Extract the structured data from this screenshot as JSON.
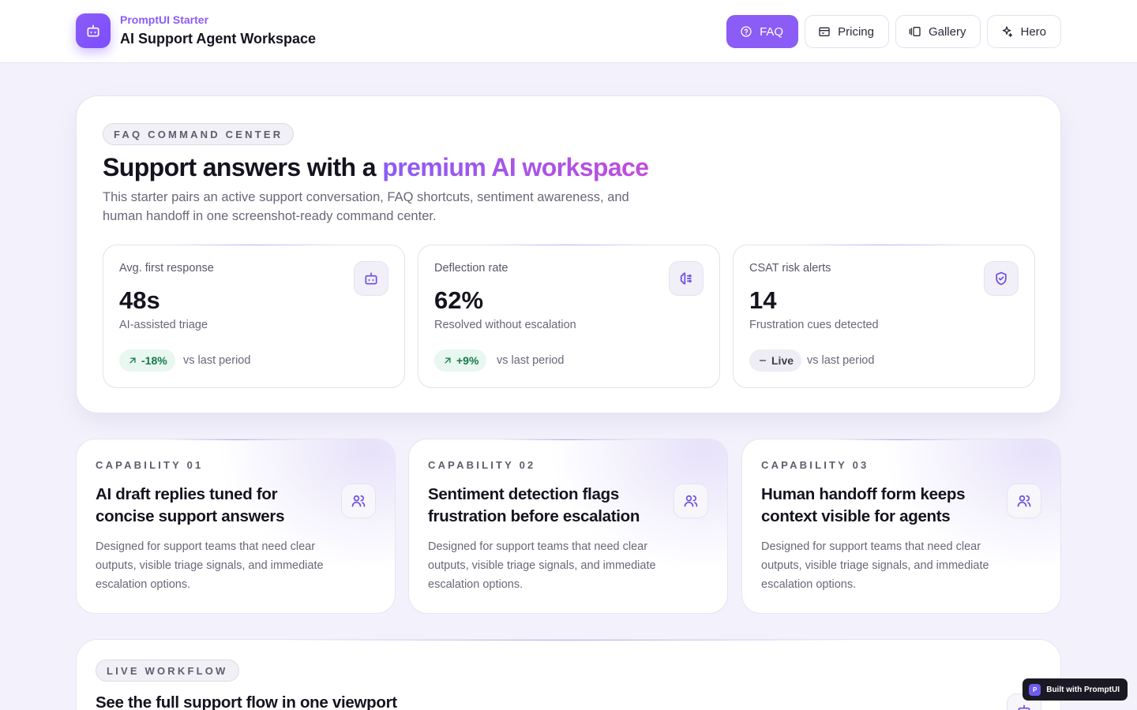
{
  "brand": {
    "eyebrow": "PromptUI Starter",
    "title": "AI Support Agent Workspace",
    "logo_icon": "bot-icon"
  },
  "nav": [
    {
      "label": "FAQ",
      "icon": "help-circle-icon",
      "active": true
    },
    {
      "label": "Pricing",
      "icon": "wallet-icon",
      "active": false
    },
    {
      "label": "Gallery",
      "icon": "gallery-icon",
      "active": false
    },
    {
      "label": "Hero",
      "icon": "sparkles-icon",
      "active": false
    }
  ],
  "hero": {
    "pill": "FAQ COMMAND CENTER",
    "title_plain": "Support answers with a ",
    "title_accent": "premium AI workspace",
    "subtitle": "This starter pairs an active support conversation, FAQ shortcuts, sentiment awareness, and human handoff in one screenshot-ready command center."
  },
  "stats": [
    {
      "label": "Avg. first response",
      "value": "48s",
      "note": "AI-assisted triage",
      "trend": "-18%",
      "trend_type": "up",
      "suffix": "vs last period",
      "icon": "bot-icon"
    },
    {
      "label": "Deflection rate",
      "value": "62%",
      "note": "Resolved without escalation",
      "trend": "+9%",
      "trend_type": "up",
      "suffix": "vs last period",
      "icon": "brain-icon"
    },
    {
      "label": "CSAT risk alerts",
      "value": "14",
      "note": "Frustration cues detected",
      "trend": "Live",
      "trend_type": "neutral",
      "suffix": "vs last period",
      "icon": "shield-check-icon"
    }
  ],
  "capabilities": [
    {
      "eyebrow": "CAPABILITY 01",
      "title": "AI draft replies tuned for concise support answers",
      "body": "Designed for support teams that need clear outputs, visible triage signals, and immediate escalation options.",
      "icon": "users-icon"
    },
    {
      "eyebrow": "CAPABILITY 02",
      "title": "Sentiment detection flags frustration before escalation",
      "body": "Designed for support teams that need clear outputs, visible triage signals, and immediate escalation options.",
      "icon": "users-icon"
    },
    {
      "eyebrow": "CAPABILITY 03",
      "title": "Human handoff form keeps context visible for agents",
      "body": "Designed for support teams that need clear outputs, visible triage signals, and immediate escalation options.",
      "icon": "users-icon"
    }
  ],
  "workflow": {
    "pill": "LIVE WORKFLOW",
    "title": "See the full support flow in one viewport",
    "icon": "bot-icon"
  },
  "badge": {
    "logo": "P",
    "label": "Built with PromptUI"
  },
  "colors": {
    "accent": "#8b5cf6",
    "accent_gradient_end": "#c14ddb",
    "trend_up_bg": "#e8f7ef",
    "trend_up_text": "#16794a",
    "page_bg": "#f3f2fc"
  }
}
